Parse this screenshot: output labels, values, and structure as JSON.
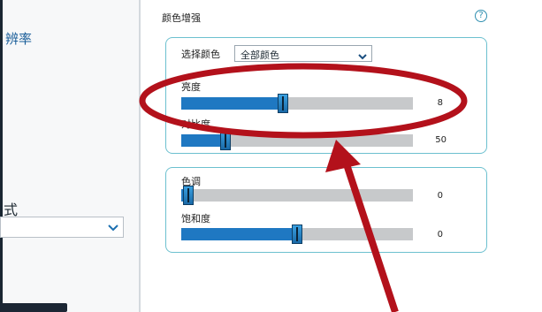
{
  "left": {
    "title": "辨率",
    "label": "式"
  },
  "color_enhancement": {
    "title": "颜色增强",
    "help": "?",
    "select_label": "选择颜色",
    "select_value": "全部颜色",
    "brightness": {
      "label": "亮度",
      "value": "8",
      "level": 0.44
    },
    "contrast": {
      "label": "对比度",
      "value": "50",
      "level": 0.19
    },
    "hue": {
      "label": "色调",
      "value": "0",
      "level": 0.03
    },
    "saturation": {
      "label": "饱和度",
      "value": "0",
      "level": 0.5
    }
  },
  "colors": {
    "accent": "#1f78c2",
    "annotation": "#b3111b",
    "group_border": "#6cc0cf"
  }
}
